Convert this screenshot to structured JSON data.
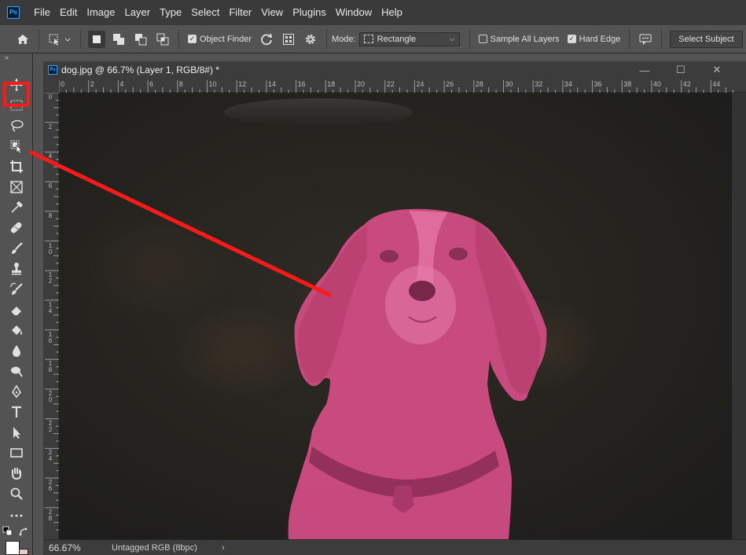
{
  "app": {
    "logo_text": "Ps"
  },
  "menu": [
    "File",
    "Edit",
    "Image",
    "Layer",
    "Type",
    "Select",
    "Filter",
    "View",
    "Plugins",
    "Window",
    "Help"
  ],
  "options_bar": {
    "object_finder_label": "Object Finder",
    "object_finder_checked": true,
    "mode_label": "Mode:",
    "mode_value": "Rectangle",
    "sample_all_layers_label": "Sample All Layers",
    "sample_all_layers_checked": false,
    "hard_edge_label": "Hard Edge",
    "hard_edge_checked": true,
    "select_subject_label": "Select Subject"
  },
  "toolbar": {
    "collapse_glyph": "»",
    "tools": [
      "move-tool-icon",
      "marquee-tool-icon",
      "lasso-tool-icon",
      "object-selection-tool-icon",
      "crop-tool-icon",
      "frame-tool-icon",
      "eyedropper-tool-icon",
      "healing-brush-tool-icon",
      "brush-tool-icon",
      "clone-stamp-tool-icon",
      "history-brush-tool-icon",
      "eraser-tool-icon",
      "paint-bucket-tool-icon",
      "blur-tool-icon",
      "dodge-tool-icon",
      "pen-tool-icon",
      "type-tool-icon",
      "path-selection-tool-icon",
      "rectangle-tool-icon",
      "hand-tool-icon",
      "zoom-tool-icon",
      "more-tools-icon"
    ],
    "active_tool": "object-selection-tool-icon",
    "foreground_color": "#ffffff",
    "background_color": "#e8c9c9"
  },
  "document": {
    "title": "dog.jpg @ 66.7% (Layer 1, RGB/8#) *",
    "ruler_top_labels": [
      "0",
      "2",
      "4",
      "6",
      "8",
      "10",
      "12",
      "14",
      "16",
      "18",
      "20",
      "22",
      "24",
      "26",
      "28",
      "30",
      "32",
      "34",
      "36",
      "38",
      "40",
      "42",
      "44"
    ],
    "ruler_left_labels": [
      "0",
      "2",
      "4",
      "6",
      "8",
      "10",
      "12",
      "14",
      "16",
      "18",
      "20",
      "22",
      "24",
      "26",
      "28"
    ],
    "zoom": "66.67%",
    "color_profile": "Untagged RGB (8bpc)",
    "status_arrow": "›"
  },
  "colors": {
    "annotation": "#ff1a1a",
    "selection_overlay": "#e0508a"
  }
}
